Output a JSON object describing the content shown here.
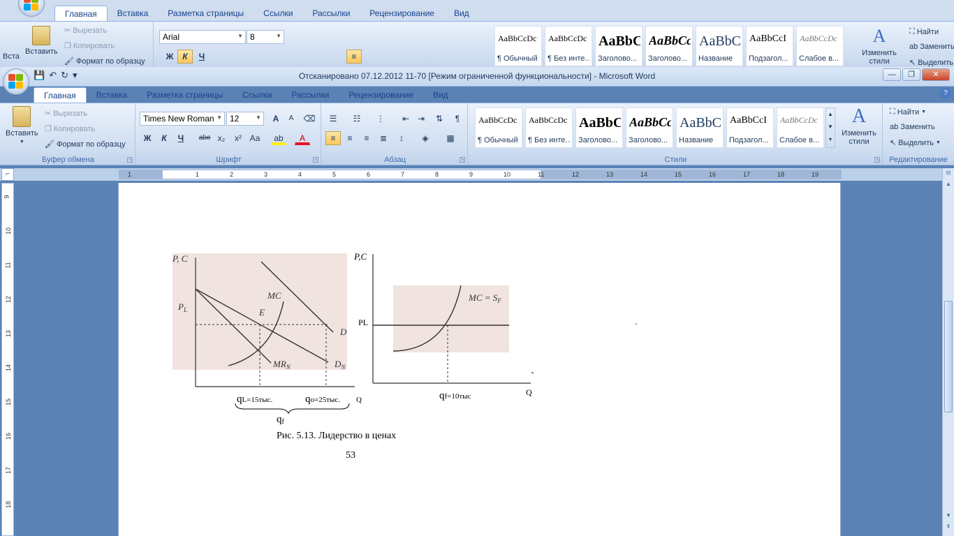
{
  "back_window": {
    "tabs": [
      "Главная",
      "Вставка",
      "Разметка страницы",
      "Ссылки",
      "Рассылки",
      "Рецензирование",
      "Вид"
    ],
    "active_tab": 0,
    "clipboard": {
      "paste": "Вставить",
      "cut": "Вырезать",
      "copy": "Копировать",
      "format_painter": "Формат по образцу"
    },
    "font": {
      "name": "Arial",
      "size": "8"
    },
    "styles": [
      {
        "sample": "AaBbCcDc",
        "name": "¶ Обычный"
      },
      {
        "sample": "AaBbCcDc",
        "name": "¶ Без инте..."
      },
      {
        "sample": "AaBbC",
        "name": "Заголово..."
      },
      {
        "sample": "AaBbCc",
        "name": "Заголово..."
      },
      {
        "sample": "AaBbC",
        "name": "Название"
      },
      {
        "sample": "AaBbCcI",
        "name": "Подзагол..."
      },
      {
        "sample": "AaBbCcDc",
        "name": "Слабое в..."
      }
    ],
    "change_styles": "Изменить стили",
    "find": "Найти",
    "replace": "Заменить",
    "select": "Выделить",
    "paste_partial": "Вста"
  },
  "window": {
    "title": "Отсканировано 07.12.2012 11-70 [Режим ограниченной функциональности] - Microsoft Word",
    "tabs": [
      "Главная",
      "Вставка",
      "Разметка страницы",
      "Ссылки",
      "Рассылки",
      "Рецензирование",
      "Вид"
    ],
    "active_tab": 0
  },
  "ribbon": {
    "clipboard": {
      "paste": "Вставить",
      "cut": "Вырезать",
      "copy": "Копировать",
      "format_painter": "Формат по образцу",
      "group_label": "Буфер обмена"
    },
    "font": {
      "name": "Times New Roman",
      "size": "12",
      "group_label": "Шрифт",
      "grow": "A",
      "shrink": "A",
      "bold": "Ж",
      "italic": "К",
      "underline": "Ч",
      "strike": "abe",
      "subscript": "x₂",
      "superscript": "x²",
      "case": "Аа",
      "highlight": "ab",
      "color": "A"
    },
    "paragraph": {
      "group_label": "Абзац",
      "pilcrow": "¶"
    },
    "styles": {
      "group_label": "Стили",
      "items": [
        {
          "sample": "AaBbCcDc",
          "name": "¶ Обычный"
        },
        {
          "sample": "AaBbCcDc",
          "name": "¶ Без инте..."
        },
        {
          "sample": "AaBbC",
          "name": "Заголово..."
        },
        {
          "sample": "AaBbCc",
          "name": "Заголово..."
        },
        {
          "sample": "AaBbC",
          "name": "Название"
        },
        {
          "sample": "AaBbCcI",
          "name": "Подзагол..."
        },
        {
          "sample": "AaBbCcDc",
          "name": "Слабое в..."
        }
      ],
      "change_styles": "Изменить стили"
    },
    "editing": {
      "group_label": "Редактирование",
      "find": "Найти",
      "replace": "Заменить",
      "select": "Выделить"
    }
  },
  "ruler": {
    "h_numbers": [
      "1",
      "1",
      "2",
      "3",
      "4",
      "5",
      "6",
      "7",
      "8",
      "9",
      "10",
      "11",
      "12",
      "13",
      "14",
      "15",
      "16",
      "17",
      "18",
      "19"
    ],
    "v_numbers": [
      "9",
      "10",
      "11",
      "12",
      "13",
      "14",
      "15",
      "16",
      "17",
      "18"
    ]
  },
  "document": {
    "figure_left": {
      "axis_pc": "P, C",
      "pl": "P",
      "pl_sub": "L",
      "mc": "MC",
      "e": "E",
      "d": "D",
      "mrn": "MR",
      "mrn_sub": "N",
      "dn": "D",
      "dn_sub": "N"
    },
    "figure_right": {
      "axis_pc": "P,C",
      "pl": "PL",
      "mc_sf": "MC = S",
      "mc_sf_sub": "F",
      "q_axis": "Q"
    },
    "labels": {
      "ql": "q",
      "ql_rest": "L=15тыс.",
      "qo": "q",
      "qo_rest": "o=25тыс.",
      "q_small": "Q",
      "qf_right": "q",
      "qf_right_rest": "f=10тыс",
      "qf_brace": "q",
      "qf_brace_sub": "f"
    },
    "caption": "Рис. 5.13. Лидерство в ценах",
    "page_number": "53"
  }
}
